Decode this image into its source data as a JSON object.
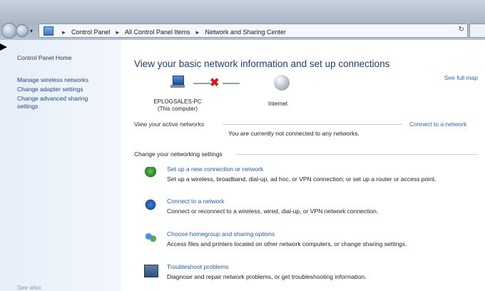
{
  "address_bar": {
    "crumbs": [
      "Control Panel",
      "All Control Panel Items",
      "Network and Sharing Center"
    ],
    "refresh": "↻"
  },
  "sidebar": {
    "home": "Control Panel Home",
    "items": [
      {
        "label": "Manage wireless networks"
      },
      {
        "label": "Change adapter settings"
      },
      {
        "label": "Change advanced sharing settings"
      }
    ],
    "see_also": "See also"
  },
  "main": {
    "heading": "View your basic network information and set up connections",
    "see_full_map": "See full map",
    "computer_name": "EPLOGSALES-PC",
    "computer_sub": "(This computer)",
    "internet_label": "Internet",
    "active_networks_label": "View your active networks",
    "connect_link": "Connect to a network",
    "status_text": "You are currently not connected to any networks.",
    "change_label": "Change your networking settings",
    "tasks": [
      {
        "title": "Set up a new connection or network",
        "desc": "Set up a wireless, broadband, dial-up, ad hoc, or VPN connection; or set up a router or access point.",
        "icon": "new-connection-icon"
      },
      {
        "title": "Connect to a network",
        "desc": "Connect or reconnect to a wireless, wired, dial-up, or VPN network connection.",
        "icon": "connect-network-icon"
      },
      {
        "title": "Choose homegroup and sharing options",
        "desc": "Access files and printers located on other network computers, or change sharing settings.",
        "icon": "homegroup-icon"
      },
      {
        "title": "Troubleshoot problems",
        "desc": "Diagnose and repair network problems, or get troubleshooting information.",
        "icon": "troubleshoot-icon"
      }
    ]
  },
  "colors": {
    "link": "#2a6bbf",
    "heading": "#1e3f7a",
    "disconnect": "#d21a1a"
  }
}
